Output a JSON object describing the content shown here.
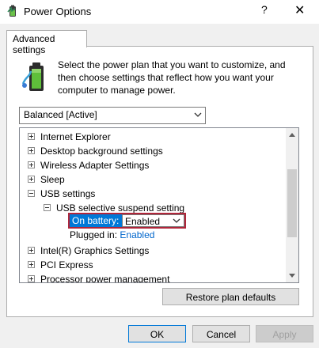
{
  "window": {
    "title": "Power Options",
    "help_glyph": "?",
    "close_glyph": "✕",
    "icon": "power-options-icon"
  },
  "tabs": [
    {
      "label": "Advanced settings",
      "active": true
    }
  ],
  "description": "Select the power plan that you want to customize, and then choose settings that reflect how you want your computer to manage power.",
  "plan_select": {
    "value": "Balanced [Active]"
  },
  "tree": {
    "items": [
      {
        "label": "Internet Explorer",
        "expander": "plus",
        "level": 0
      },
      {
        "label": "Desktop background settings",
        "expander": "plus",
        "level": 0
      },
      {
        "label": "Wireless Adapter Settings",
        "expander": "plus",
        "level": 0
      },
      {
        "label": "Sleep",
        "expander": "plus",
        "level": 0
      },
      {
        "label": "USB settings",
        "expander": "minus",
        "level": 0
      },
      {
        "label": "USB selective suspend setting",
        "expander": "minus",
        "level": 1
      },
      {
        "label": "Intel(R) Graphics Settings",
        "expander": "plus",
        "level": 0
      },
      {
        "label": "PCI Express",
        "expander": "plus",
        "level": 0
      },
      {
        "label": "Processor power management",
        "expander": "plus",
        "level": 0
      }
    ]
  },
  "on_battery": {
    "label": "On battery:",
    "value": "Enabled"
  },
  "plugged_in": {
    "label": "Plugged in:",
    "value": "Enabled"
  },
  "buttons": {
    "restore": "Restore plan defaults",
    "ok": "OK",
    "cancel": "Cancel",
    "apply": "Apply"
  },
  "colors": {
    "accent": "#0078d7",
    "highlight_border": "#b0263a",
    "link": "#0066cc"
  }
}
